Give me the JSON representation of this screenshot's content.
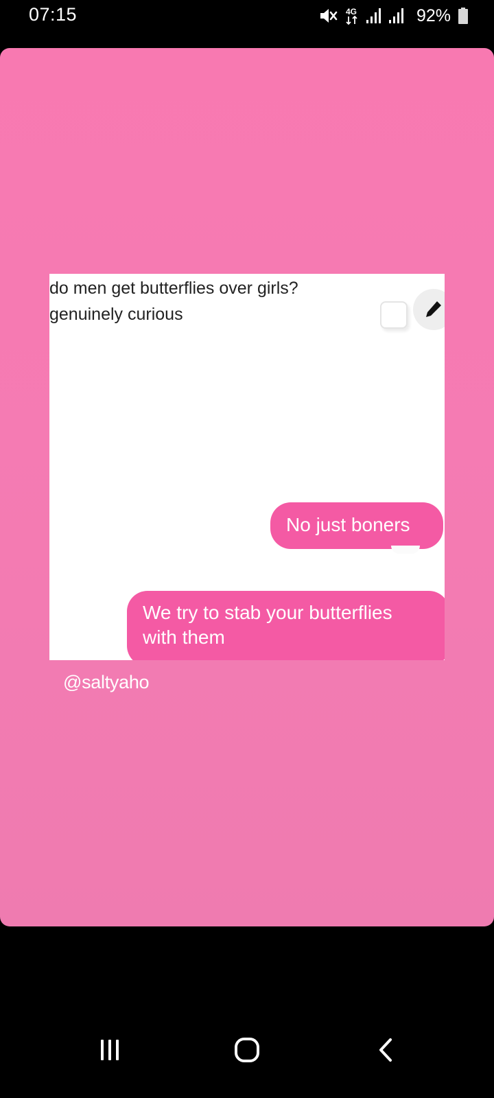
{
  "status_bar": {
    "time": "07:15",
    "network_label": "4G",
    "battery_percent": "92%",
    "icons": [
      "mute-icon",
      "network-4g-icon",
      "signal-icon",
      "signal-icon",
      "battery-icon"
    ]
  },
  "image": {
    "question_line1": "do men get butterflies over girls?",
    "question_line2": "genuinely curious",
    "bubbles": [
      {
        "text": "No just boners"
      },
      {
        "line1": "We try to stab your butterflies",
        "line2": "with them"
      }
    ],
    "icons": [
      "checkbox-icon",
      "edit-pencil-icon"
    ]
  },
  "watermark": "@saltyaho",
  "nav_bar": {
    "buttons": [
      "recents-button",
      "home-button",
      "back-button"
    ]
  },
  "colors": {
    "card_background": "#f879b1",
    "bubble": "#f45aa4",
    "text_dark": "#222222",
    "status_bar": "#000000"
  }
}
